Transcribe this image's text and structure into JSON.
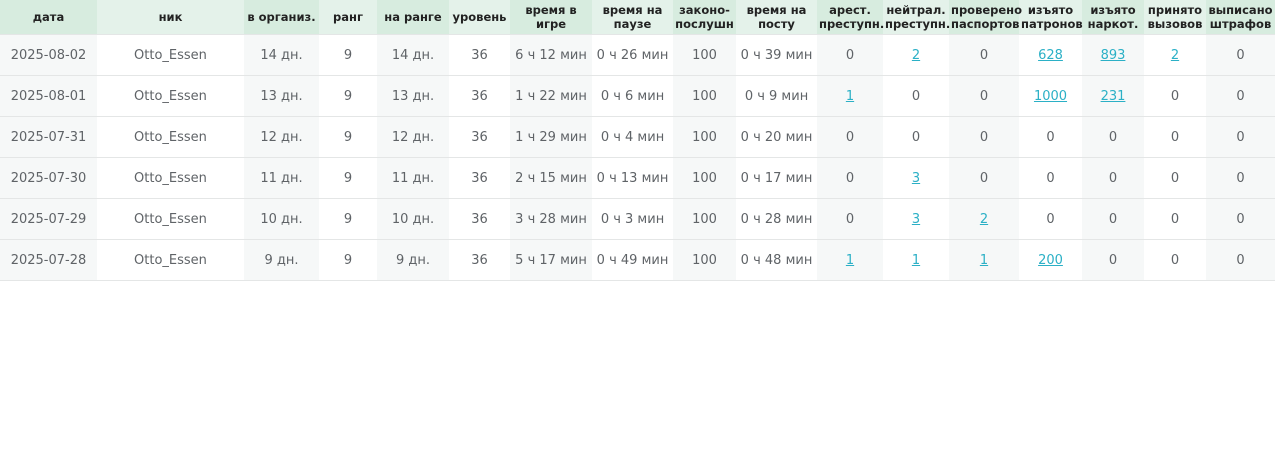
{
  "table": {
    "columns": [
      {
        "key": "date",
        "label": "дата",
        "width": 97,
        "alt": true
      },
      {
        "key": "nick",
        "label": "ник",
        "width": 147,
        "alt": false
      },
      {
        "key": "in_org",
        "label": "в организ.",
        "width": 75,
        "alt": true
      },
      {
        "key": "rank",
        "label": "ранг",
        "width": 58,
        "alt": false
      },
      {
        "key": "on_rank",
        "label": "на ранге",
        "width": 72,
        "alt": true
      },
      {
        "key": "level",
        "label": "уровень",
        "width": 61,
        "alt": false
      },
      {
        "key": "time_in_game",
        "label": "время в\nигре",
        "width": 82,
        "alt": true
      },
      {
        "key": "time_paused",
        "label": "время на\nпаузе",
        "width": 81,
        "alt": false
      },
      {
        "key": "law_abiding",
        "label": "законо-\nпослушн",
        "width": 63,
        "alt": true
      },
      {
        "key": "time_on_post",
        "label": "время на\nпосту",
        "width": 81,
        "alt": false
      },
      {
        "key": "arrested",
        "label": "арест.\nпреступн.",
        "width": 66,
        "alt": true
      },
      {
        "key": "neutralized",
        "label": "нейтрал.\nпреступн.",
        "width": 66,
        "alt": false
      },
      {
        "key": "passports_checked",
        "label": "проверено\nпаспортов",
        "width": 70,
        "alt": true
      },
      {
        "key": "ammo_seized",
        "label": "изъято\nпатронов",
        "width": 63,
        "alt": false
      },
      {
        "key": "drugs_seized",
        "label": "изъято\nнаркот.",
        "width": 62,
        "alt": true
      },
      {
        "key": "calls_accepted",
        "label": "принято\nвызовов",
        "width": 62,
        "alt": false
      },
      {
        "key": "fines_issued",
        "label": "выписано\nштрафов",
        "width": 69,
        "alt": true
      }
    ],
    "rows": [
      {
        "date": "2025-08-02",
        "nick": "Otto_Essen",
        "in_org": "14 дн.",
        "rank": "9",
        "on_rank": "14 дн.",
        "level": "36",
        "time_in_game": "6 ч 12 мин",
        "time_paused": "0 ч 26 мин",
        "law_abiding": "100",
        "time_on_post": "0 ч 39 мин",
        "arrested": "0",
        "neutralized": "2",
        "passports_checked": "0",
        "ammo_seized": "628",
        "drugs_seized": "893",
        "calls_accepted": "2",
        "fines_issued": "0"
      },
      {
        "date": "2025-08-01",
        "nick": "Otto_Essen",
        "in_org": "13 дн.",
        "rank": "9",
        "on_rank": "13 дн.",
        "level": "36",
        "time_in_game": "1 ч 22 мин",
        "time_paused": "0 ч 6 мин",
        "law_abiding": "100",
        "time_on_post": "0 ч 9 мин",
        "arrested": "1",
        "neutralized": "0",
        "passports_checked": "0",
        "ammo_seized": "1000",
        "drugs_seized": "231",
        "calls_accepted": "0",
        "fines_issued": "0"
      },
      {
        "date": "2025-07-31",
        "nick": "Otto_Essen",
        "in_org": "12 дн.",
        "rank": "9",
        "on_rank": "12 дн.",
        "level": "36",
        "time_in_game": "1 ч 29 мин",
        "time_paused": "0 ч 4 мин",
        "law_abiding": "100",
        "time_on_post": "0 ч 20 мин",
        "arrested": "0",
        "neutralized": "0",
        "passports_checked": "0",
        "ammo_seized": "0",
        "drugs_seized": "0",
        "calls_accepted": "0",
        "fines_issued": "0"
      },
      {
        "date": "2025-07-30",
        "nick": "Otto_Essen",
        "in_org": "11 дн.",
        "rank": "9",
        "on_rank": "11 дн.",
        "level": "36",
        "time_in_game": "2 ч 15 мин",
        "time_paused": "0 ч 13 мин",
        "law_abiding": "100",
        "time_on_post": "0 ч 17 мин",
        "arrested": "0",
        "neutralized": "3",
        "passports_checked": "0",
        "ammo_seized": "0",
        "drugs_seized": "0",
        "calls_accepted": "0",
        "fines_issued": "0"
      },
      {
        "date": "2025-07-29",
        "nick": "Otto_Essen",
        "in_org": "10 дн.",
        "rank": "9",
        "on_rank": "10 дн.",
        "level": "36",
        "time_in_game": "3 ч 28 мин",
        "time_paused": "0 ч 3 мин",
        "law_abiding": "100",
        "time_on_post": "0 ч 28 мин",
        "arrested": "0",
        "neutralized": "3",
        "passports_checked": "2",
        "ammo_seized": "0",
        "drugs_seized": "0",
        "calls_accepted": "0",
        "fines_issued": "0"
      },
      {
        "date": "2025-07-28",
        "nick": "Otto_Essen",
        "in_org": "9 дн.",
        "rank": "9",
        "on_rank": "9 дн.",
        "level": "36",
        "time_in_game": "5 ч 17 мин",
        "time_paused": "0 ч 49 мин",
        "law_abiding": "100",
        "time_on_post": "0 ч 48 мин",
        "arrested": "1",
        "neutralized": "1",
        "passports_checked": "1",
        "ammo_seized": "200",
        "drugs_seized": "0",
        "calls_accepted": "0",
        "fines_issued": "0"
      }
    ],
    "link_columns": [
      "arrested",
      "neutralized",
      "passports_checked",
      "ammo_seized",
      "drugs_seized",
      "calls_accepted",
      "fines_issued"
    ],
    "colors": {
      "header_bg": "#e4f2ea",
      "header_bg_alt": "#d7ecdf",
      "cell_bg_alt": "#f6f8f8",
      "text": "#5f6367",
      "link": "#2bb0c6"
    }
  }
}
